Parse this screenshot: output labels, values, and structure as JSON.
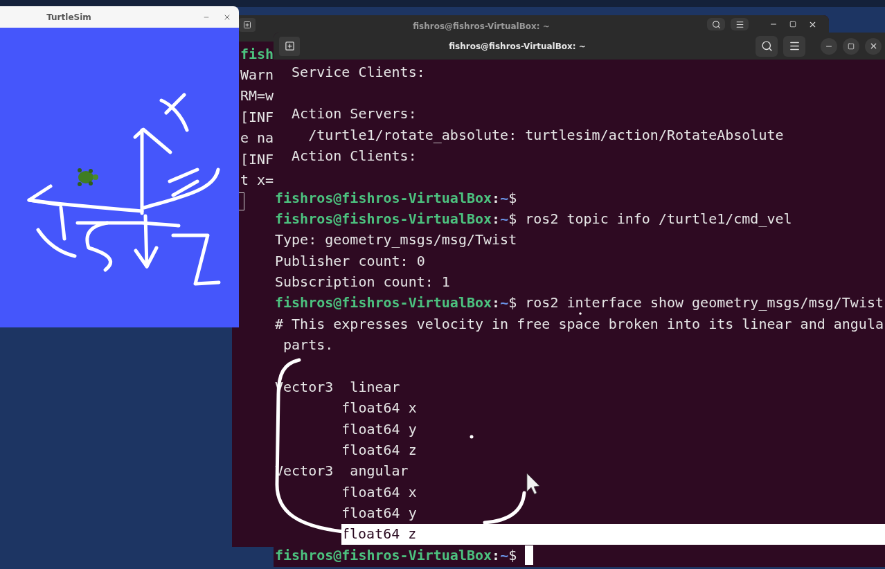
{
  "turtlesim": {
    "title": "TurtleSim"
  },
  "back_terminal": {
    "title": "fishros@fishros-VirtualBox: ~",
    "lines": [
      {
        "kind": "prompt_fragment",
        "text": "fish"
      },
      {
        "kind": "output",
        "text": "Warn"
      },
      {
        "kind": "output",
        "text": "RM=w"
      },
      {
        "kind": "output",
        "text": "[INF"
      },
      {
        "kind": "output",
        "text": "e na"
      },
      {
        "kind": "output",
        "text": "[INF"
      },
      {
        "kind": "output",
        "text": "t x="
      },
      {
        "kind": "cursor"
      }
    ]
  },
  "front_terminal": {
    "title": "fishros@fishros-VirtualBox: ~",
    "lines": [
      {
        "kind": "output",
        "text": "  Service Clients:"
      },
      {
        "kind": "blank"
      },
      {
        "kind": "output",
        "text": "  Action Servers:"
      },
      {
        "kind": "output",
        "text": "    /turtle1/rotate_absolute: turtlesim/action/RotateAbsolute"
      },
      {
        "kind": "output",
        "text": "  Action Clients:"
      },
      {
        "kind": "blank"
      },
      {
        "kind": "prompt",
        "user_host": "fishros@fishros-VirtualBox",
        "separator": ":",
        "cwd": "~",
        "symbol": "$"
      },
      {
        "kind": "prompt",
        "user_host": "fishros@fishros-VirtualBox",
        "separator": ":",
        "cwd": "~",
        "symbol": "$",
        "command": "ros2 topic info /turtle1/cmd_vel"
      },
      {
        "kind": "output",
        "text": "Type: geometry_msgs/msg/Twist"
      },
      {
        "kind": "output",
        "text": "Publisher count: 0"
      },
      {
        "kind": "output",
        "text": "Subscription count: 1"
      },
      {
        "kind": "prompt",
        "user_host": "fishros@fishros-VirtualBox",
        "separator": ":",
        "cwd": "~",
        "symbol": "$",
        "command": "ros2 interface show geometry_msgs/msg/Twist"
      },
      {
        "kind": "output",
        "text": "# This expresses velocity in free space broken into its linear and angula"
      },
      {
        "kind": "output",
        "text": " parts."
      },
      {
        "kind": "blank"
      },
      {
        "kind": "output",
        "text": "Vector3  linear"
      },
      {
        "kind": "output",
        "text": "        float64 x"
      },
      {
        "kind": "output",
        "text": "        float64 y"
      },
      {
        "kind": "output",
        "text": "        float64 z"
      },
      {
        "kind": "output",
        "text": "Vector3  angular"
      },
      {
        "kind": "output",
        "text": "        float64 x"
      },
      {
        "kind": "output",
        "text": "        float64 y"
      },
      {
        "kind": "highlight",
        "text": "        float64 z"
      },
      {
        "kind": "active_prompt",
        "user_host": "fishros@fishros-VirtualBox",
        "separator": ":",
        "cwd": "~",
        "symbol": "$"
      }
    ]
  }
}
